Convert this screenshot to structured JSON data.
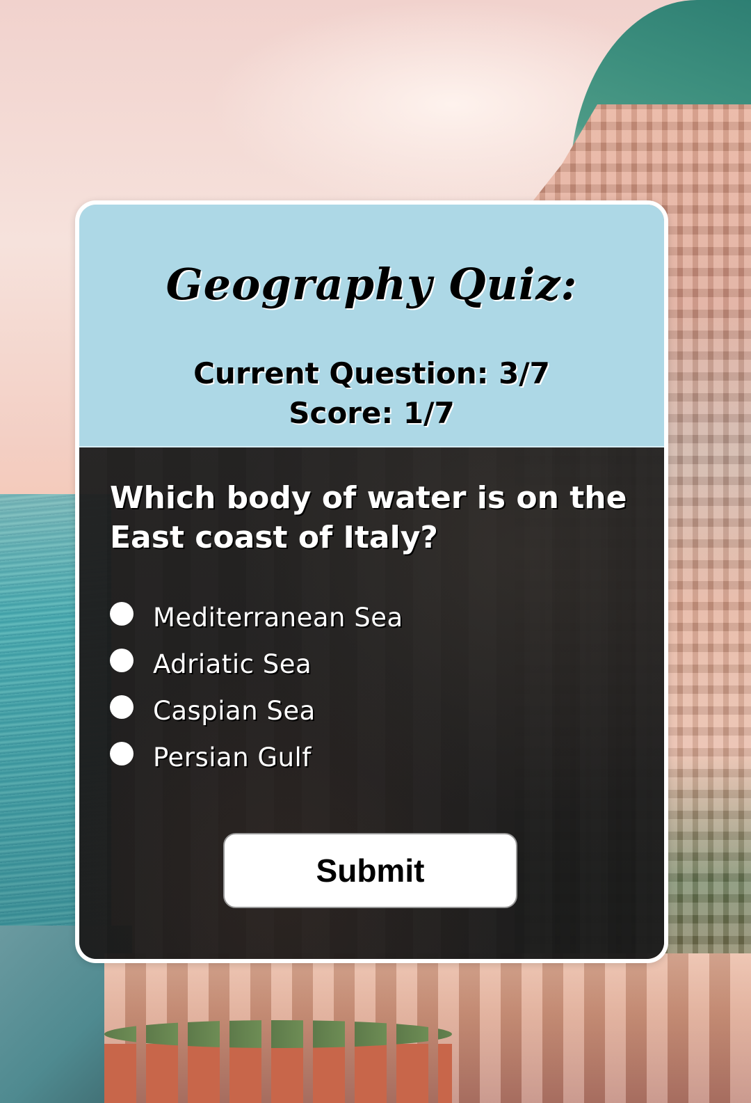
{
  "quiz": {
    "title": "Geography Quiz:",
    "current_question": "Current Question: 3/7",
    "score": "Score: 1/7"
  },
  "question": {
    "text": "Which body of water is on the East coast of Italy?",
    "options": [
      {
        "label": "Mediterranean Sea",
        "selected": false
      },
      {
        "label": "Adriatic Sea",
        "selected": false
      },
      {
        "label": "Caspian Sea",
        "selected": false
      },
      {
        "label": "Persian Gulf",
        "selected": false
      }
    ]
  },
  "actions": {
    "submit_label": "Submit"
  },
  "colors": {
    "header_bg": "#add8e6",
    "body_bg": "#1c1c1c",
    "card_border": "#ffffff",
    "button_bg": "#ffffff"
  }
}
